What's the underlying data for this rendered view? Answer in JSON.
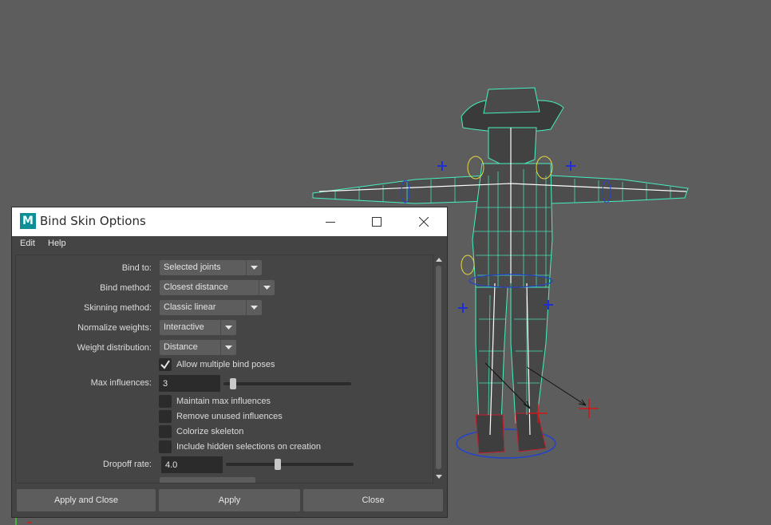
{
  "window": {
    "title": "Bind Skin Options",
    "logo_letter": "M",
    "controls": [
      "minimize-icon",
      "maximize-icon",
      "close-icon"
    ]
  },
  "menu": {
    "edit": "Edit",
    "help": "Help"
  },
  "options": {
    "bind_to": {
      "label": "Bind to:",
      "value": "Selected joints"
    },
    "bind_method": {
      "label": "Bind method:",
      "value": "Closest distance"
    },
    "skinning_method": {
      "label": "Skinning method:",
      "value": "Classic linear"
    },
    "normalize_weights": {
      "label": "Normalize weights:",
      "value": "Interactive"
    },
    "weight_distribution": {
      "label": "Weight distribution:",
      "value": "Distance"
    },
    "allow_multiple_bind_poses": {
      "label": "Allow multiple bind poses",
      "checked": true
    },
    "max_influences": {
      "label": "Max influences:",
      "value": "3",
      "slider_fraction": 0.05
    },
    "maintain_max_influences": {
      "label": "Maintain max influences",
      "checked": false
    },
    "remove_unused_influences": {
      "label": "Remove unused influences",
      "checked": false
    },
    "colorize_skeleton": {
      "label": "Colorize skeleton",
      "checked": false
    },
    "include_hidden_selections": {
      "label": "Include hidden selections on creation",
      "checked": false
    },
    "dropoff_rate": {
      "label": "Dropoff rate:",
      "value": "4.0",
      "slider_fraction": 0.4
    }
  },
  "buttons": {
    "apply_and_close": "Apply and Close",
    "apply": "Apply",
    "close": "Close"
  },
  "colors": {
    "viewport_bg": "#5d5d5d",
    "wireframe": "#46f0c0",
    "joint_locator": "#1f2dd6",
    "ik_handle": "#d01616",
    "maya_logo": "#0e8f95"
  }
}
